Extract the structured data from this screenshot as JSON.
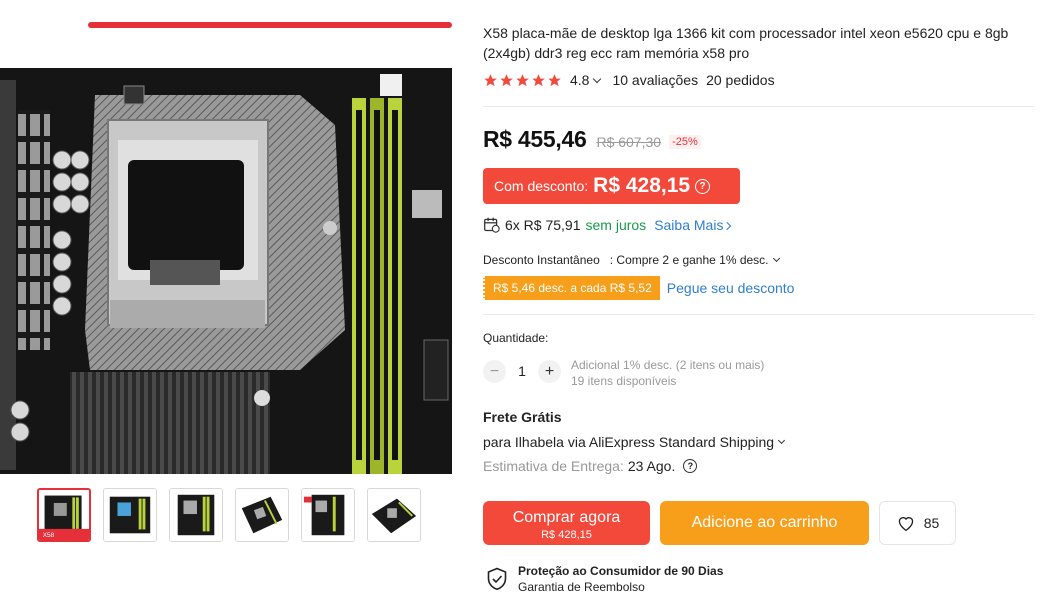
{
  "product": {
    "title": "X58 placa-mãe de desktop lga 1366 kit com processador intel xeon e5620 cpu e 8gb (2x4gb) ddr3 reg ecc ram memória x58 pro",
    "rating": "4.8",
    "reviews": "10 avaliações",
    "orders": "20 pedidos",
    "star_color": "#f2493a"
  },
  "price": {
    "current": "R$ 455,46",
    "original": "R$ 607,30",
    "off": "-25%"
  },
  "discount": {
    "label": "Com desconto:",
    "price": "R$ 428,15",
    "help_icon": "?"
  },
  "installments": {
    "text": "6x R$ 75,91",
    "interest": "sem juros",
    "link": "Saiba Mais"
  },
  "instant": {
    "label": "Desconto Instantâneo",
    "offer": ": Compre 2 e ganhe 1% desc."
  },
  "coupon": {
    "text": "R$ 5,46 desc. a cada R$ 5,52",
    "link": "Pegue seu desconto"
  },
  "quantity": {
    "label": "Quantidade:",
    "minus": "−",
    "plus": "+",
    "value": "1",
    "extra": "Adicional 1% desc. (2 itens ou mais)",
    "available": "19 itens disponíveis"
  },
  "shipping": {
    "title": "Frete Grátis",
    "destination": "para Ilhabela via AliExpress Standard Shipping",
    "estimate_label": "Estimativa de Entrega:",
    "estimate_date": "23 Ago.",
    "help_icon": "?"
  },
  "actions": {
    "buy_label": "Comprar agora",
    "buy_price": "R$ 428,15",
    "cart_label": "Adicione ao carrinho",
    "wish_count": "85"
  },
  "protection": {
    "title": "Proteção ao Consumidor de 90 Dias",
    "subtitle": "Garantia de Reembolso"
  },
  "gallery": {
    "active_index": 0,
    "thumbnail_count": 6,
    "thumb1_badge": "X58"
  },
  "colors": {
    "red": "#f2493a",
    "orange": "#f79e1b",
    "link": "#2e7fd1",
    "green": "#1a9a4a",
    "ram_slot": "#b9d43a"
  }
}
